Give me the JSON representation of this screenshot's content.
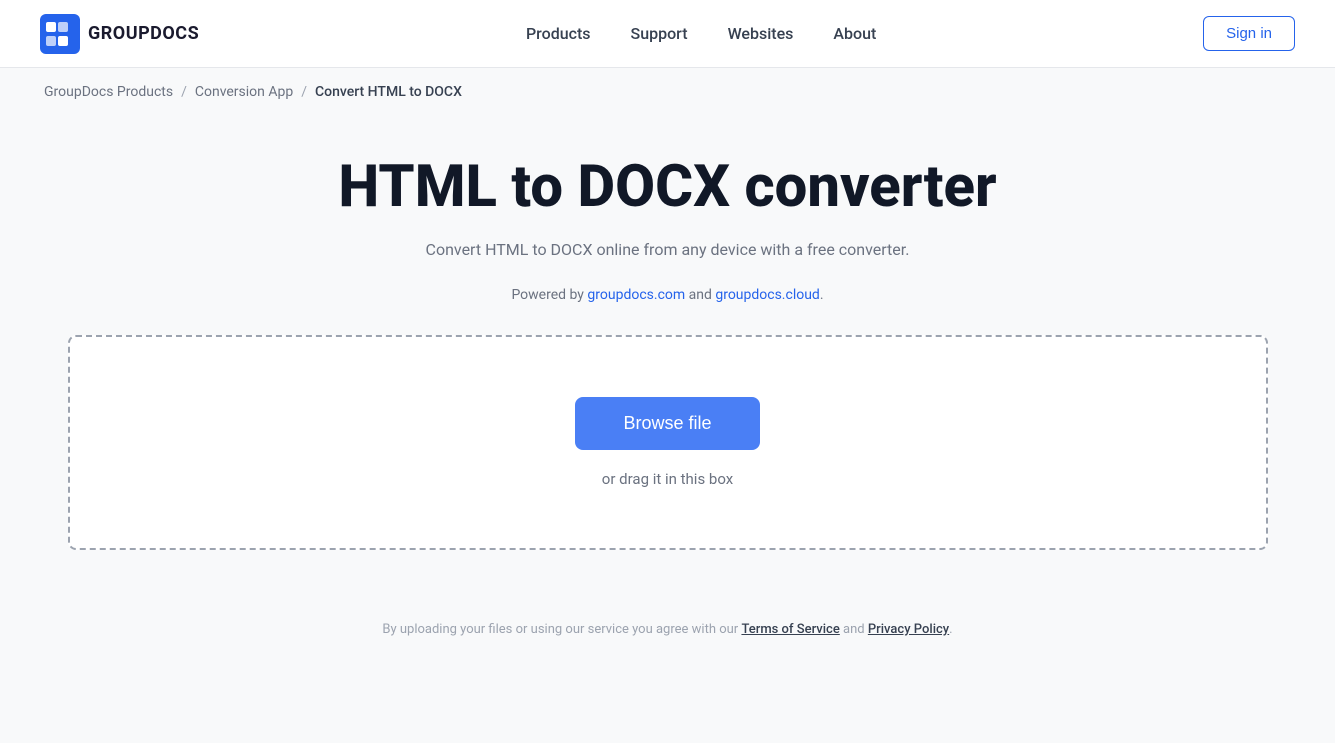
{
  "header": {
    "logo_text": "GROUPDOCS",
    "nav_items": [
      {
        "label": "Products",
        "href": "#"
      },
      {
        "label": "Support",
        "href": "#"
      },
      {
        "label": "Websites",
        "href": "#"
      },
      {
        "label": "About",
        "href": "#"
      }
    ],
    "sign_in_label": "Sign in"
  },
  "breadcrumb": {
    "items": [
      {
        "label": "GroupDocs Products",
        "href": "#"
      },
      {
        "label": "Conversion App",
        "href": "#"
      }
    ],
    "current": "Convert HTML to DOCX"
  },
  "main": {
    "page_title": "HTML to DOCX converter",
    "subtitle": "Convert HTML to DOCX online from any device with a free converter.",
    "powered_by_prefix": "Powered by ",
    "powered_by_link1_label": "groupdocs.com",
    "powered_by_link1_href": "#",
    "powered_by_and": " and ",
    "powered_by_link2_label": "groupdocs.cloud",
    "powered_by_link2_href": "#",
    "powered_by_suffix": ".",
    "drop_zone": {
      "browse_button_label": "Browse file",
      "drag_text": "or drag it in this box"
    }
  },
  "footer_note": {
    "prefix": "By uploading your files or using our service you agree with our ",
    "tos_label": "Terms of Service",
    "and": " and ",
    "pp_label": "Privacy Policy",
    "suffix": "."
  }
}
